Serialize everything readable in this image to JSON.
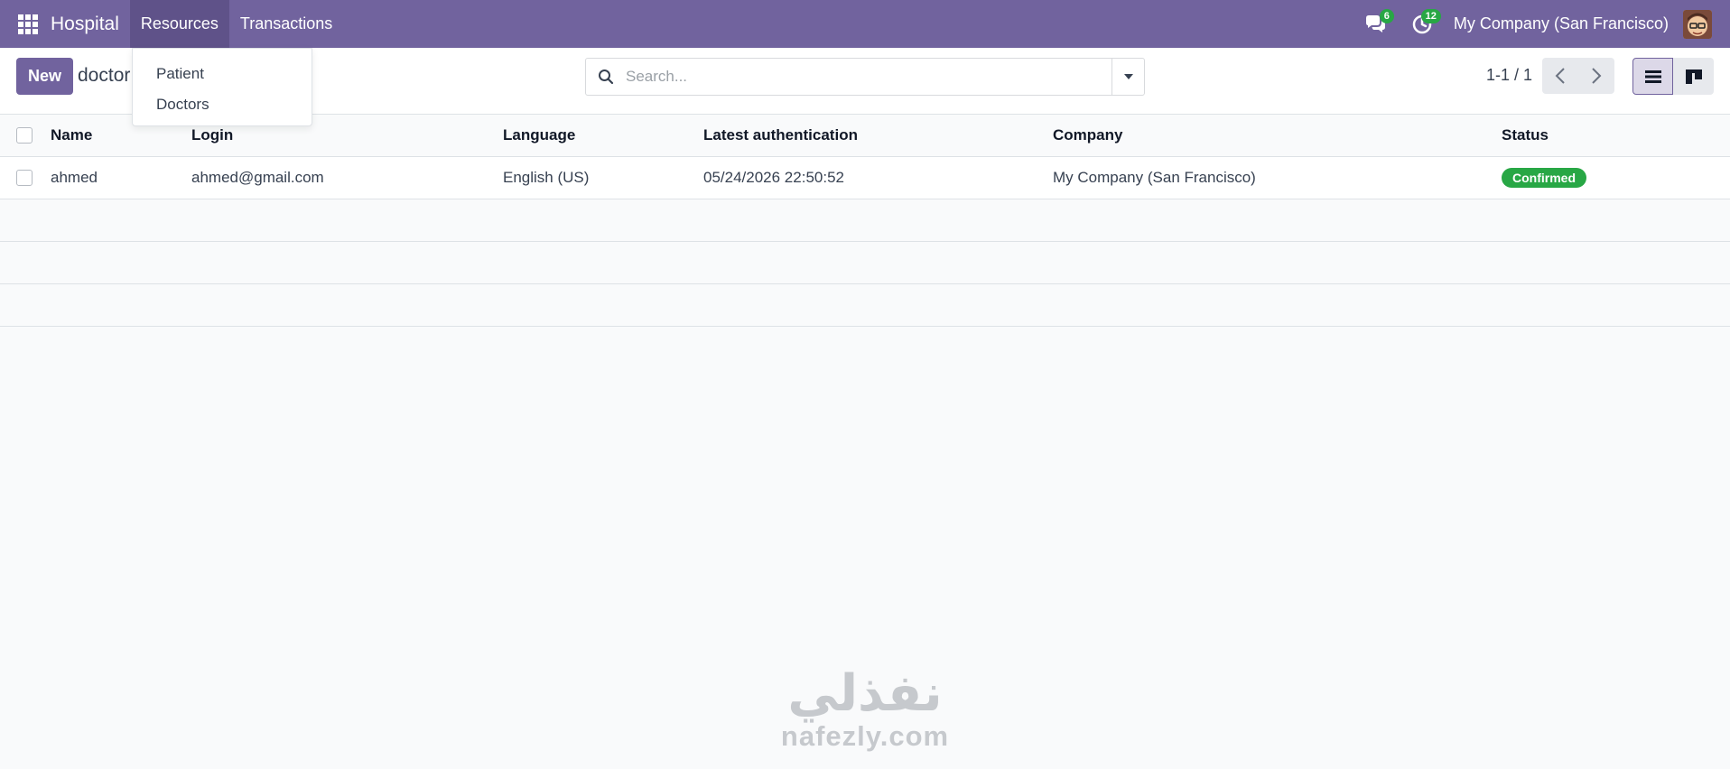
{
  "navbar": {
    "app_name": "Hospital",
    "menus": [
      {
        "label": "Resources"
      },
      {
        "label": "Transactions"
      }
    ],
    "messages_count": "6",
    "activities_count": "12",
    "company": "My Company (San Francisco)",
    "icons": {
      "apps": "apps-grid-icon",
      "messages": "chat-icon",
      "activities": "clock-icon",
      "avatar": "user-avatar"
    }
  },
  "resources_dropdown": {
    "items": [
      {
        "label": "Patient"
      },
      {
        "label": "Doctors"
      }
    ]
  },
  "control_panel": {
    "new_label": "New",
    "breadcrumb": "doctor",
    "search_placeholder": "Search...",
    "pager": "1-1 / 1"
  },
  "table": {
    "columns": [
      "Name",
      "Login",
      "Language",
      "Latest authentication",
      "Company",
      "Status"
    ],
    "rows": [
      {
        "name": "ahmed",
        "login": "ahmed@gmail.com",
        "language": "English (US)",
        "latest_authentication": "05/24/2026 22:50:52",
        "company": "My Company (San Francisco)",
        "status": "Confirmed"
      }
    ]
  },
  "watermark": {
    "arabic": "نفذلي",
    "latin": "nafezly.com"
  },
  "colors": {
    "navbar": "#71639e",
    "primary": "#71639e",
    "status_confirmed": "#28a745",
    "badge": "#28a745"
  }
}
